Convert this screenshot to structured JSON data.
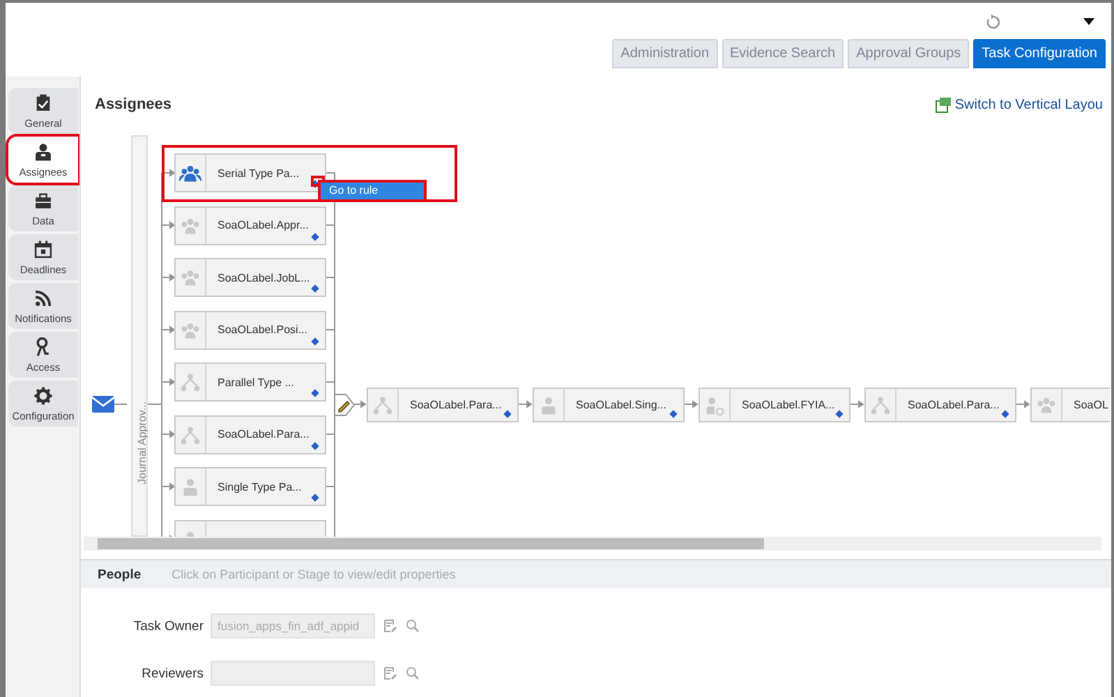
{
  "top_tabs": [
    {
      "label": "Administration",
      "selected": false
    },
    {
      "label": "Evidence Search",
      "selected": false
    },
    {
      "label": "Approval Groups",
      "selected": false
    },
    {
      "label": "Task Configuration",
      "selected": true
    }
  ],
  "sidebar": {
    "items": [
      {
        "label": "General",
        "selected": false,
        "highlighted": false
      },
      {
        "label": "Assignees",
        "selected": true,
        "highlighted": true
      },
      {
        "label": "Data",
        "selected": false,
        "highlighted": false
      },
      {
        "label": "Deadlines",
        "selected": false,
        "highlighted": false
      },
      {
        "label": "Notifications",
        "selected": false,
        "highlighted": false
      },
      {
        "label": "Access",
        "selected": false,
        "highlighted": false
      },
      {
        "label": "Configuration",
        "selected": false,
        "highlighted": false
      }
    ]
  },
  "panel": {
    "title": "Assignees",
    "layout_link": "Switch to Vertical Layou"
  },
  "diagram": {
    "stage_label": "Journal Approv...",
    "stages": [
      {
        "label": "Serial Type Pa...",
        "kind": "group",
        "highlighted": true,
        "dot_highlighted": true
      },
      {
        "label": "SoaOLabel.Appr...",
        "kind": "people",
        "highlighted": false,
        "dot_highlighted": false
      },
      {
        "label": "SoaOLabel.JobL...",
        "kind": "people",
        "highlighted": false,
        "dot_highlighted": false
      },
      {
        "label": "SoaOLabel.Posi...",
        "kind": "people",
        "highlighted": false,
        "dot_highlighted": false
      },
      {
        "label": "Parallel Type ...",
        "kind": "hierarchy",
        "highlighted": false,
        "dot_highlighted": false
      },
      {
        "label": "SoaOLabel.Para...",
        "kind": "hierarchy",
        "highlighted": false,
        "dot_highlighted": false
      },
      {
        "label": "Single Type Pa...",
        "kind": "person",
        "highlighted": false,
        "dot_highlighted": false
      },
      {
        "kind": "person",
        "highlighted": false
      }
    ],
    "context_menu": {
      "item": "Go to rule",
      "highlighted": true
    },
    "chain": [
      {
        "label": "SoaOLabel.Para...",
        "kind": "hierarchy"
      },
      {
        "label": "SoaOLabel.Sing...",
        "kind": "person"
      },
      {
        "label": "SoaOLabel.FYIA...",
        "kind": "fyi"
      },
      {
        "label": "SoaOLabel.Para...",
        "kind": "hierarchy"
      },
      {
        "label": "SoaOL",
        "kind": "people"
      }
    ]
  },
  "people": {
    "title": "People",
    "hint": "Click on Participant or Stage to view/edit properties",
    "fields": [
      {
        "label": "Task Owner",
        "value": "fusion_apps_fin_adf_appid"
      },
      {
        "label": "Reviewers"
      }
    ]
  }
}
